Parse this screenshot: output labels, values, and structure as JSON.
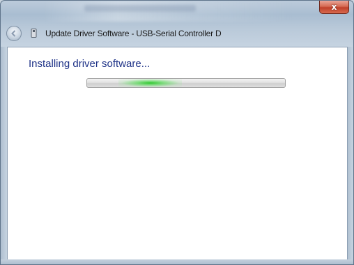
{
  "window": {
    "title": "Update Driver Software - USB-Serial Controller D",
    "close_label": "x"
  },
  "icons": {
    "back": "back-arrow-icon",
    "app": "usb-device-icon",
    "close": "close-icon"
  },
  "content": {
    "heading": "Installing driver software..."
  },
  "progress": {
    "mode": "indeterminate",
    "color": "#2ec82e"
  },
  "colors": {
    "heading": "#1e3287",
    "close_button": "#c0402a",
    "frame": "#b9c9d9"
  }
}
